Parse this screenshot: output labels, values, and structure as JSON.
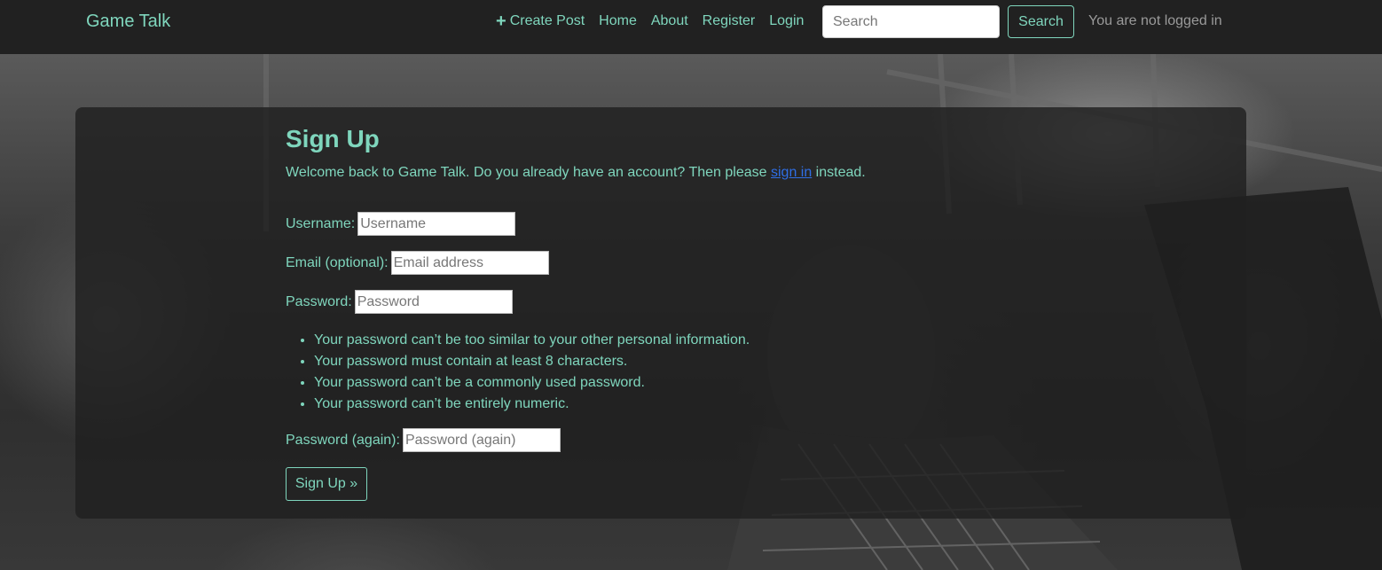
{
  "navbar": {
    "brand": "Game Talk",
    "links": [
      {
        "label": "Create Post",
        "icon": "plus-icon"
      },
      {
        "label": "Home"
      },
      {
        "label": "About"
      },
      {
        "label": "Register"
      },
      {
        "label": "Login"
      }
    ],
    "search": {
      "placeholder": "Search",
      "value": "",
      "button_label": "Search"
    },
    "status": "You are not logged in"
  },
  "signup": {
    "title": "Sign Up",
    "intro_before": "Welcome back to Game Talk. Do you already have an account? Then please ",
    "intro_link": "sign in",
    "intro_after": " instead.",
    "fields": [
      {
        "label": "Username:",
        "placeholder": "Username",
        "value": ""
      },
      {
        "label": "Email (optional):",
        "placeholder": "Email address",
        "value": ""
      },
      {
        "label": "Password:",
        "placeholder": "Password",
        "value": ""
      },
      {
        "label": "Password (again):",
        "placeholder": "Password (again)",
        "value": ""
      }
    ],
    "password_help": [
      "Your password can’t be too similar to your other personal information.",
      "Your password must contain at least 8 characters.",
      "Your password can’t be a commonly used password.",
      "Your password can’t be entirely numeric."
    ],
    "submit_label": "Sign Up »"
  },
  "colors": {
    "accent": "#7fd6bd",
    "navbar_bg": "#212121",
    "link": "#2f6fe6",
    "muted_text": "#9a9a9a"
  }
}
